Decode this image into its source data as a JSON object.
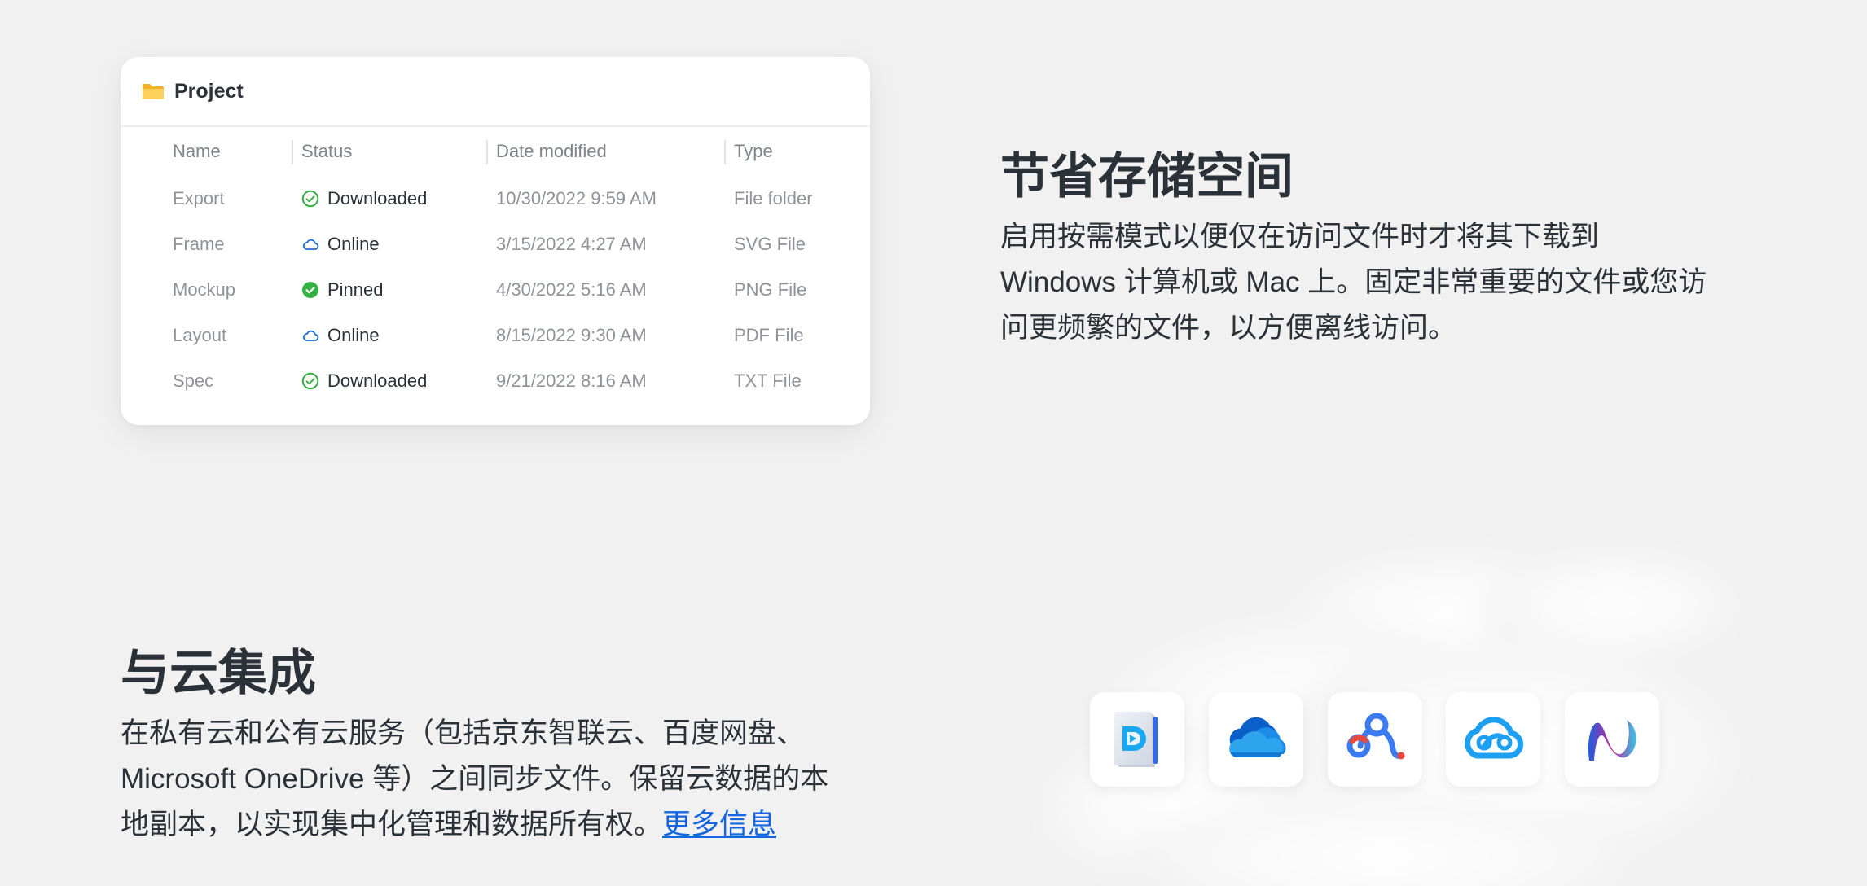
{
  "file_card": {
    "title": "Project",
    "columns": {
      "name": "Name",
      "status": "Status",
      "date": "Date modified",
      "type": "Type"
    },
    "rows": [
      {
        "name": "Export",
        "status": "Downloaded",
        "status_icon": "check-circle-outline-icon",
        "date": "10/30/2022 9:59 AM",
        "type": "File folder"
      },
      {
        "name": "Frame",
        "status": "Online",
        "status_icon": "cloud-outline-icon",
        "date": "3/15/2022 4:27 AM",
        "type": "SVG File"
      },
      {
        "name": "Mockup",
        "status": "Pinned",
        "status_icon": "check-circle-filled-icon",
        "date": "4/30/2022 5:16 AM",
        "type": "PNG File"
      },
      {
        "name": "Layout",
        "status": "Online",
        "status_icon": "cloud-outline-icon",
        "date": "8/15/2022 9:30 AM",
        "type": "PDF File"
      },
      {
        "name": "Spec",
        "status": "Downloaded",
        "status_icon": "check-circle-outline-icon",
        "date": "9/21/2022 8:16 AM",
        "type": "TXT File"
      }
    ]
  },
  "storage_section": {
    "heading": "节省存储空间",
    "lines": [
      "启用按需模式以便仅在访问文件时才将其下载到",
      "Windows 计算机或 Mac 上。固定非常重要的文件或您访",
      "问更频繁的文件，以方便离线访问。"
    ]
  },
  "cloud_section": {
    "heading": "与云集成",
    "lines": [
      "在私有云和公有云服务（包括京东智联云、百度网盘、",
      "Microsoft OneDrive 等）之间同步文件。保留云数据的本",
      "地副本，以实现集中化管理和数据所有权。"
    ],
    "link_text": "更多信息",
    "apps": [
      "jd-cloud-icon",
      "onedrive-icon",
      "baidu-netdisk-icon",
      "tencent-cloud-icon",
      "nas-app-icon"
    ]
  },
  "colors": {
    "background": "#f1f1f1",
    "text": "#2b3138",
    "muted": "#8f9399",
    "link": "#1266e0",
    "downloaded_green": "#35b045",
    "online_blue": "#1e6fd9"
  }
}
